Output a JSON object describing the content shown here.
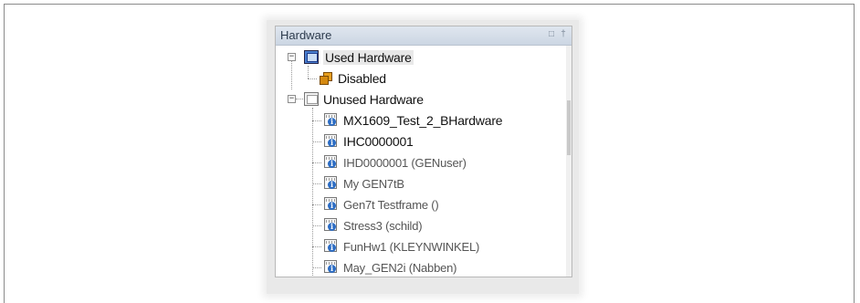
{
  "panel": {
    "title": "Hardware",
    "header_buttons": [
      "window-restore-icon",
      "pin-icon"
    ]
  },
  "tree": {
    "used": {
      "label": "Used Hardware",
      "icon": "used-hardware-icon",
      "expanded": true
    },
    "disabled": {
      "label": "Disabled",
      "icon": "disabled-folder-icon"
    },
    "unused": {
      "label": "Unused Hardware",
      "icon": "unused-hardware-icon",
      "expanded": true
    },
    "items": [
      {
        "label": "MX1609_Test_2_BHardware",
        "style": "dark"
      },
      {
        "label": "IHC0000001",
        "style": "dark"
      },
      {
        "label": "IHD0000001 (GENuser)",
        "style": "grey"
      },
      {
        "label": "My GEN7tB",
        "style": "grey"
      },
      {
        "label": "Gen7t Testframe ()",
        "style": "grey"
      },
      {
        "label": "Stress3 (schild)",
        "style": "grey"
      },
      {
        "label": "FunHw1 (KLEYNWINKEL)",
        "style": "grey"
      },
      {
        "label": "May_GEN2i (Nabben)",
        "style": "grey"
      }
    ],
    "item_icon": "hardware-info-icon"
  }
}
